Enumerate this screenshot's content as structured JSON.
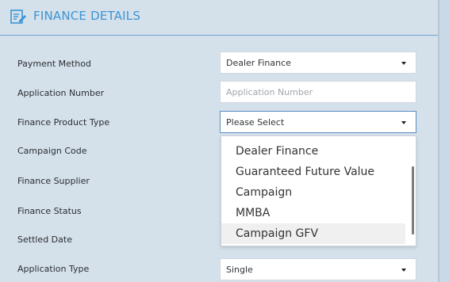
{
  "header": {
    "title": "FINANCE DETAILS",
    "icon": "edit-document-icon",
    "accent": "#3c95d6"
  },
  "form": {
    "payment_method": {
      "label": "Payment Method",
      "value": "Dealer Finance"
    },
    "application_number": {
      "label": "Application Number",
      "placeholder": "Application Number"
    },
    "finance_product_type": {
      "label": "Finance Product Type",
      "value": "Please Select"
    },
    "campaign_code": {
      "label": "Campaign Code"
    },
    "finance_supplier": {
      "label": "Finance Supplier"
    },
    "finance_status": {
      "label": "Finance Status"
    },
    "settled_date": {
      "label": "Settled Date"
    },
    "application_type": {
      "label": "Application Type",
      "value": "Single"
    }
  },
  "dropdown": {
    "options": [
      "Dealer Finance",
      "Guaranteed Future Value",
      "Campaign",
      "MMBA",
      "Campaign GFV"
    ],
    "highlighted": "Campaign GFV"
  }
}
